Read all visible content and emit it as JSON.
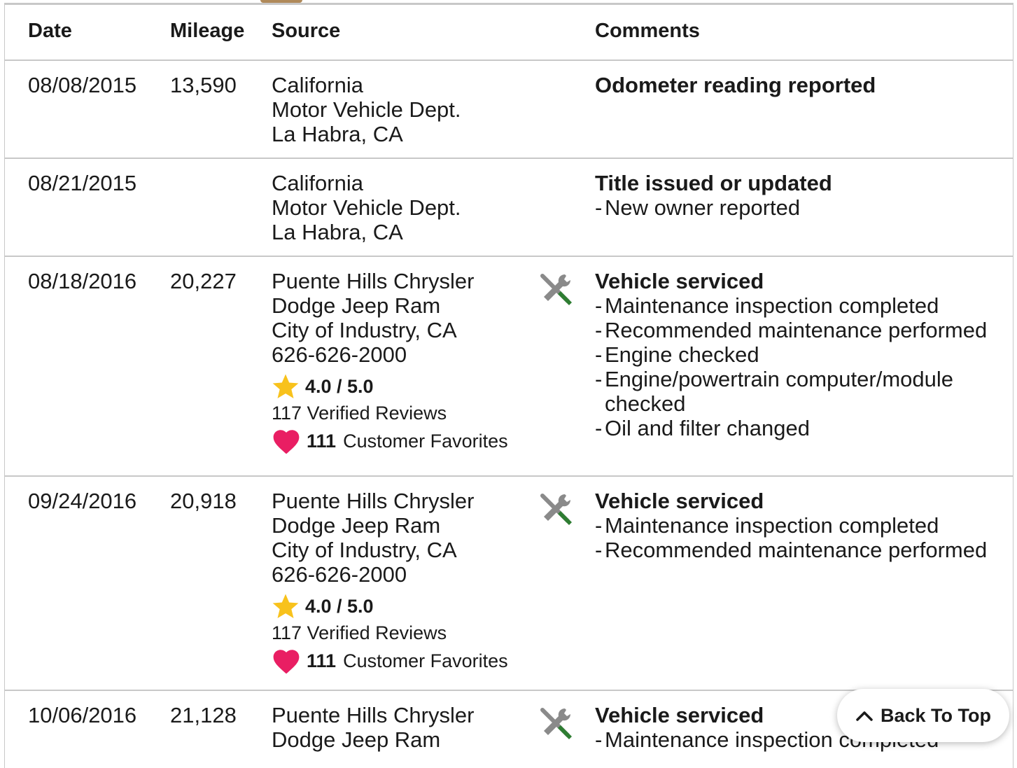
{
  "table": {
    "headers": {
      "date": "Date",
      "mileage": "Mileage",
      "source": "Source",
      "comments": "Comments"
    },
    "rows": [
      {
        "date": "08/08/2015",
        "mileage": "13,590",
        "source": [
          "California",
          "Motor Vehicle Dept.",
          "La Habra, CA"
        ],
        "comment_title": "Odometer reading reported",
        "comment_items": []
      },
      {
        "date": "08/21/2015",
        "mileage": "",
        "source": [
          "California",
          "Motor Vehicle Dept.",
          "La Habra, CA"
        ],
        "comment_title": "Title issued or updated",
        "comment_items": [
          "New owner reported"
        ]
      },
      {
        "date": "08/18/2016",
        "mileage": "20,227",
        "source": [
          "Puente Hills Chrysler",
          "Dodge Jeep Ram",
          "City of Industry, CA",
          "626-626-2000"
        ],
        "rating": "4.0 / 5.0",
        "reviews": "117 Verified Reviews",
        "favorites_count": "111",
        "favorites_label": "Customer Favorites",
        "icon": "service-tools-icon",
        "comment_title": "Vehicle serviced",
        "comment_items": [
          "Maintenance inspection completed",
          "Recommended maintenance performed",
          "Engine checked",
          "Engine/powertrain computer/module checked",
          "Oil and filter changed"
        ]
      },
      {
        "date": "09/24/2016",
        "mileage": "20,918",
        "source": [
          "Puente Hills Chrysler",
          "Dodge Jeep Ram",
          "City of Industry, CA",
          "626-626-2000"
        ],
        "rating": "4.0 / 5.0",
        "reviews": "117 Verified Reviews",
        "favorites_count": "111",
        "favorites_label": "Customer Favorites",
        "icon": "service-tools-icon",
        "comment_title": "Vehicle serviced",
        "comment_items": [
          "Maintenance inspection completed",
          "Recommended maintenance performed"
        ]
      },
      {
        "date": "10/06/2016",
        "mileage": "21,128",
        "source": [
          "Puente Hills Chrysler",
          "Dodge Jeep Ram"
        ],
        "icon": "service-tools-icon",
        "comment_title": "Vehicle serviced",
        "comment_items": [
          "Maintenance inspection completed"
        ]
      }
    ]
  },
  "back_to_top": {
    "label": "Back To Top",
    "icon": "chevron-up-icon"
  },
  "colors": {
    "star": "#f8c21c",
    "heart": "#e91e63",
    "tool_grey": "#8a8a8a",
    "tool_green": "#2e7d32",
    "border": "#c8c8c8"
  }
}
